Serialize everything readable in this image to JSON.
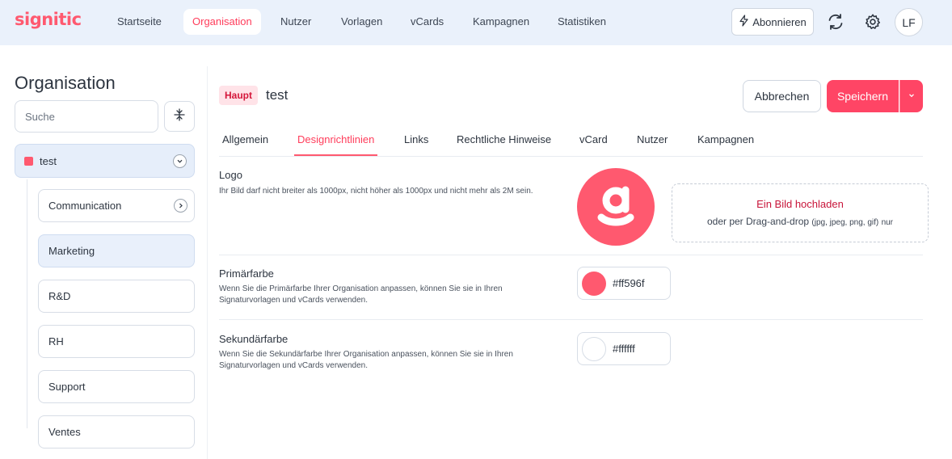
{
  "app": {
    "brand": "signitic"
  },
  "nav": {
    "items": [
      {
        "label": "Startseite",
        "active": false
      },
      {
        "label": "Organisation",
        "active": true
      },
      {
        "label": "Nutzer",
        "active": false
      },
      {
        "label": "Vorlagen",
        "active": false
      },
      {
        "label": "vCards",
        "active": false
      },
      {
        "label": "Kampagnen",
        "active": false
      },
      {
        "label": "Statistiken",
        "active": false
      }
    ],
    "subscribe_label": "Abonnieren",
    "avatar_initials": "LF"
  },
  "sidebar": {
    "title": "Organisation",
    "search_placeholder": "Suche",
    "root": {
      "label": "test",
      "color": "#ff596f"
    },
    "items": [
      {
        "label": "Communication"
      },
      {
        "label": "Marketing"
      },
      {
        "label": "R&D"
      },
      {
        "label": "RH"
      },
      {
        "label": "Support"
      },
      {
        "label": "Ventes"
      }
    ]
  },
  "main": {
    "tag": "Haupt",
    "org_name": "test",
    "cancel_label": "Abbrechen",
    "save_label": "Speichern",
    "tabs": [
      {
        "label": "Allgemein"
      },
      {
        "label": "Designrichtlinien",
        "active": true
      },
      {
        "label": "Links"
      },
      {
        "label": "Rechtliche Hinweise"
      },
      {
        "label": "vCard"
      },
      {
        "label": "Nutzer"
      },
      {
        "label": "Kampagnen"
      }
    ],
    "logo": {
      "title": "Logo",
      "desc": "Ihr Bild darf nicht breiter als 1000px, nicht höher als 1000px und nicht mehr als 2M sein.",
      "upload_title": "Ein Bild hochladen",
      "upload_sub": "oder per Drag-and-drop",
      "upload_formats": "(jpg, jpeg, png, gif)",
      "upload_suffix": "nur"
    },
    "primary": {
      "title": "Primärfarbe",
      "desc": "Wenn Sie die Primärfarbe Ihrer Organisation anpassen, können Sie sie in Ihren Signaturvorlagen und vCards verwenden.",
      "value": "#ff596f"
    },
    "secondary": {
      "title": "Sekundärfarbe",
      "desc": "Wenn Sie die Sekundärfarbe Ihrer Organisation anpassen, können Sie sie in Ihren Signaturvorlagen und vCards verwenden.",
      "value": "#ffffff"
    }
  },
  "colors": {
    "accent": "#ff596f",
    "save": "#ff4565",
    "nav_bg": "#eaf1fb"
  }
}
